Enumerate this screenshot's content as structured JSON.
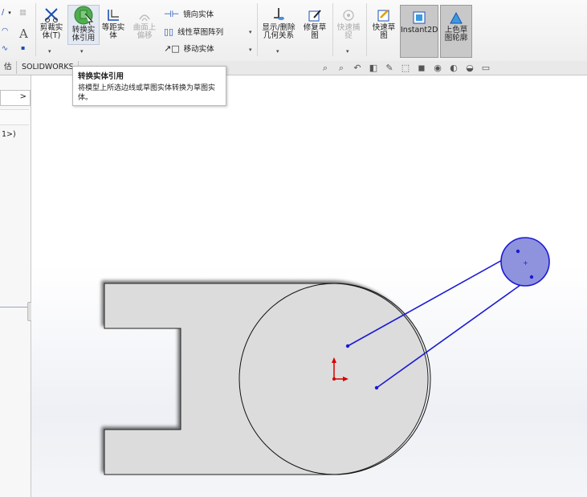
{
  "ribbon": {
    "trim": "剪裁实\n体(T)",
    "convert": "转换实\n体引用",
    "offset": "等距实\n体",
    "surface_offset": "曲面上\n偏移",
    "mirror": "镜向实体",
    "linear_pattern": "线性草图阵列",
    "move": "移动实体",
    "show_relations": "显示/删除\n几何关系",
    "repair": "修复草\n图",
    "quick_snap": "快速捕\n捉",
    "rapid_sketch": "快速草\n图",
    "instant2d": "Instant2D",
    "shaded_contour": "上色草\n图轮廓"
  },
  "tabs": {
    "first": "估",
    "solidworks": "SOLIDWORKS"
  },
  "tooltip": {
    "title": "转换实体引用",
    "desc": "将模型上所选边线或草图实体转换为草图实体。"
  },
  "panel": {
    "item": "1>)",
    "nav_arrow": ">"
  },
  "colors": {
    "sketch_line": "#1a1ad6",
    "part_fill": "#dcdcdc",
    "highlight_circle": "#8f93dd",
    "origin": "#d40000"
  }
}
